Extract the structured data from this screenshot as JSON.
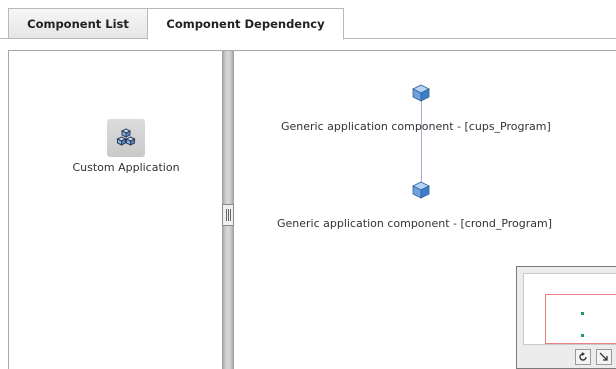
{
  "tabs": [
    {
      "label": "Component List",
      "active": false
    },
    {
      "label": "Component Dependency",
      "active": true
    }
  ],
  "left_panel": {
    "application": {
      "label": "Custom Application",
      "icon": "cubes-icon"
    }
  },
  "graph": {
    "nodes": [
      {
        "label": "Generic application component - [cups_Program]",
        "icon": "cube-icon"
      },
      {
        "label": "Generic application component - [crond_Program]",
        "icon": "cube-icon"
      }
    ]
  },
  "overview": {
    "buttons": [
      {
        "icon": "refresh-icon"
      },
      {
        "icon": "resize-corner-icon"
      }
    ]
  },
  "colors": {
    "cube_top": "#b5d3f2",
    "cube_side": "#3e7fc9",
    "edge": "#a9a9c9",
    "viewport": "#e88080",
    "overview_dot": "#1f9a58"
  }
}
